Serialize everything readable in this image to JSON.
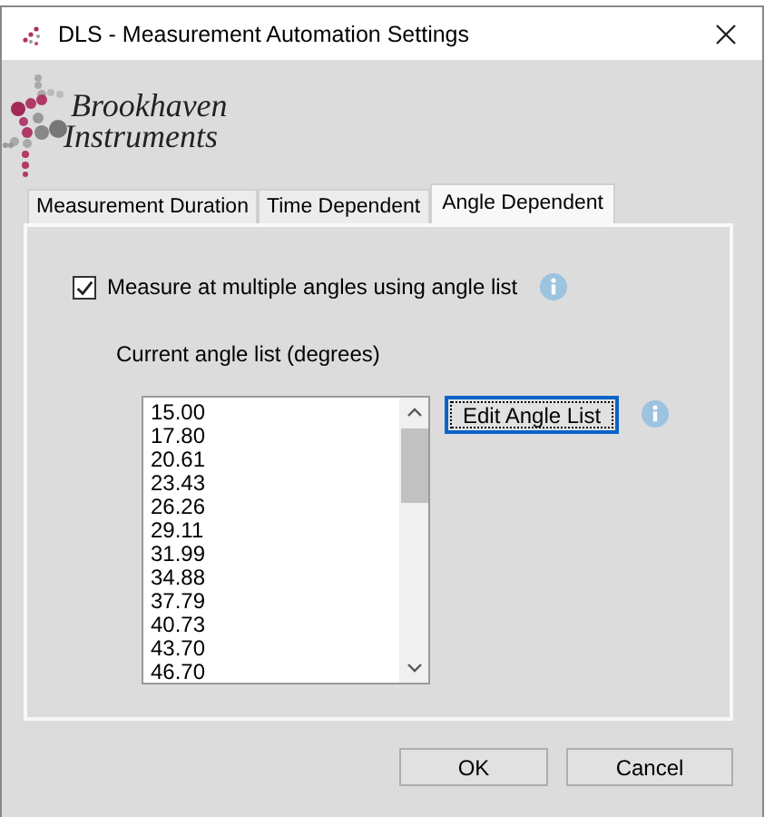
{
  "window": {
    "title": "DLS - Measurement Automation Settings"
  },
  "logo": {
    "lines": [
      "Brookhaven",
      "Instruments"
    ]
  },
  "tabs": [
    {
      "label": "Measurement Duration",
      "selected": false
    },
    {
      "label": "Time Dependent",
      "selected": false
    },
    {
      "label": "Angle Dependent",
      "selected": true
    }
  ],
  "option": {
    "label": "Measure at multiple angles using angle list",
    "checked": true
  },
  "angle_list": {
    "label": "Current angle list (degrees)",
    "items": [
      "15.00",
      "17.80",
      "20.61",
      "23.43",
      "26.26",
      "29.11",
      "31.99",
      "34.88",
      "37.79",
      "40.73",
      "43.70",
      "46.70"
    ]
  },
  "edit_button": {
    "label": "Edit Angle List",
    "focused": true
  },
  "buttons": [
    "OK",
    "Cancel"
  ]
}
